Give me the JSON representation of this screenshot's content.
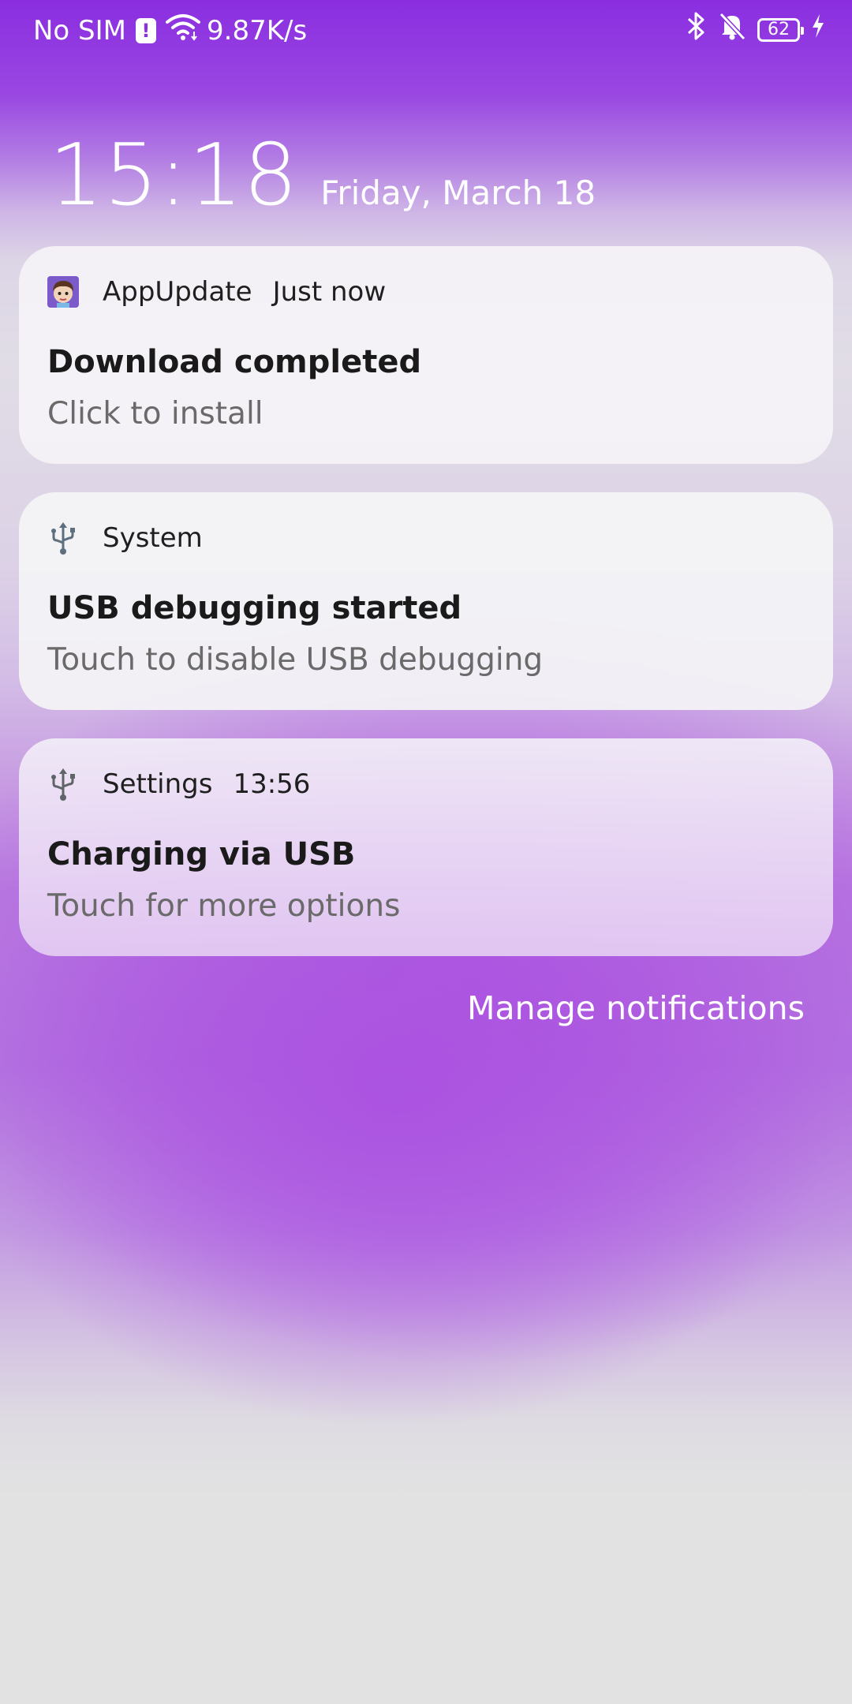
{
  "status_bar": {
    "carrier": "No SIM",
    "sim_alert": "!",
    "net_speed": "9.87K/s",
    "battery": "62",
    "icons": [
      "sim-alert-icon",
      "wifi-icon",
      "bluetooth-icon",
      "silent-bell-icon",
      "battery-icon",
      "charging-bolt-icon"
    ]
  },
  "lockscreen": {
    "time": "15:18",
    "date": "Friday, March 18"
  },
  "notifications": [
    {
      "app": "AppUpdate",
      "time": "Just now",
      "title": "Download completed",
      "text": "Click to install",
      "icon": "app-update-avatar-icon"
    },
    {
      "app": "System",
      "time": "",
      "title": "USB debugging started",
      "text": "Touch to disable USB debugging",
      "icon": "usb-icon"
    },
    {
      "app": "Settings",
      "time": "13:56",
      "title": "Charging via USB",
      "text": "Touch for more options",
      "icon": "usb-icon"
    }
  ],
  "manage_label": "Manage notifications"
}
